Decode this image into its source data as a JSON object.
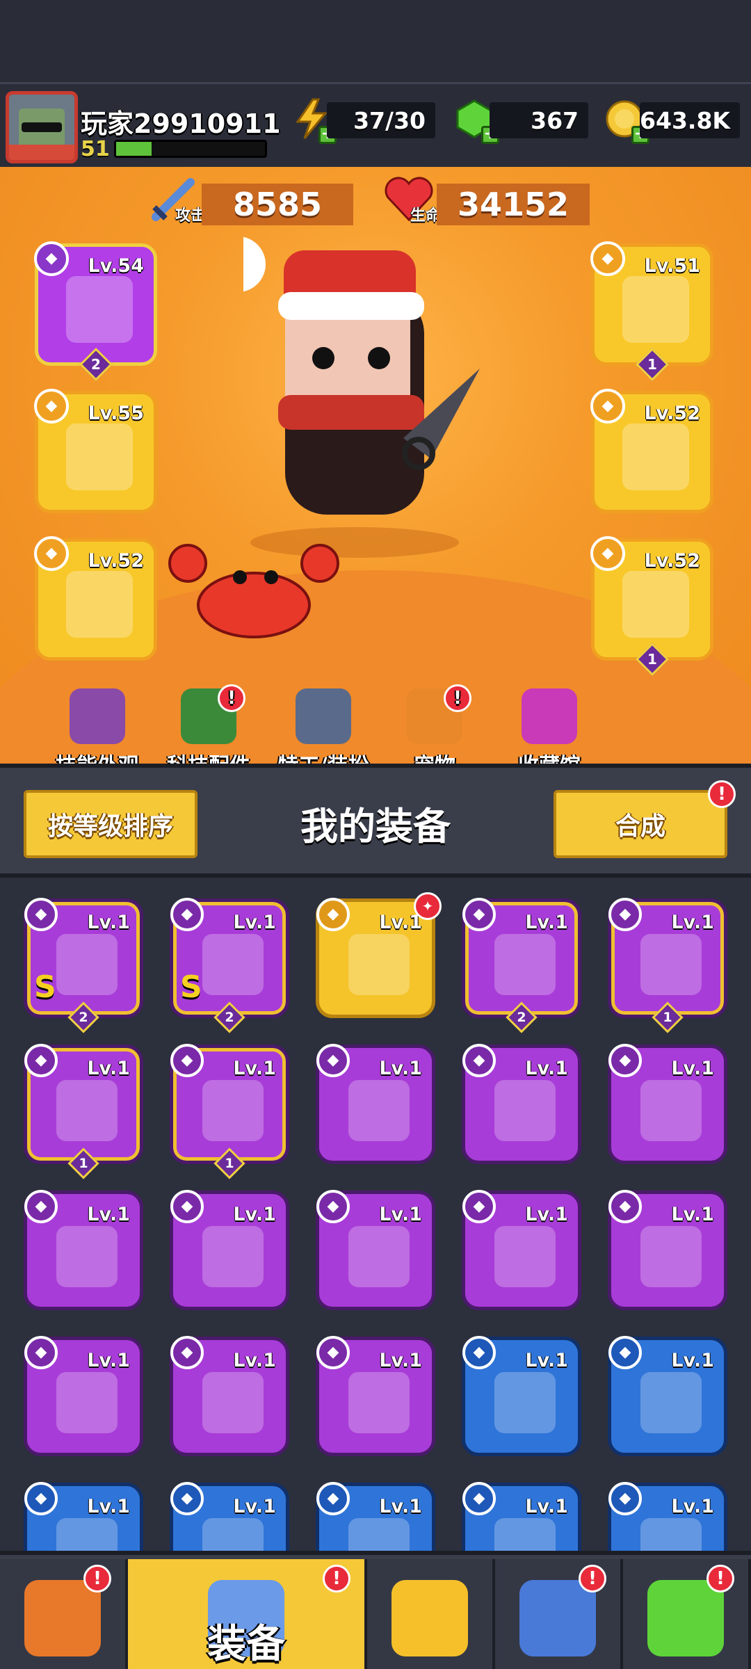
{
  "player": {
    "name": "玩家29910911",
    "level": "51",
    "xp_fraction": 0.24
  },
  "resources": {
    "energy": "37/30",
    "gems": "367",
    "coins": "643.8K"
  },
  "stats": {
    "attack_label": "攻击",
    "attack": "8585",
    "hp_label": "生命",
    "hp": "34152"
  },
  "equipped": [
    {
      "slot": "weapon",
      "level": "Lv.54",
      "rarity": "purple",
      "icon": "kunai-icon",
      "stars": "2"
    },
    {
      "slot": "armor",
      "level": "Lv.51",
      "rarity": "yellow",
      "icon": "armor-icon",
      "stars": "1"
    },
    {
      "slot": "necklace",
      "level": "Lv.55",
      "rarity": "yellow",
      "icon": "necklace-icon",
      "stars": ""
    },
    {
      "slot": "belt",
      "level": "Lv.52",
      "rarity": "yellow",
      "icon": "belt-icon",
      "stars": ""
    },
    {
      "slot": "glove",
      "level": "Lv.52",
      "rarity": "yellow",
      "icon": "glove-icon",
      "stars": ""
    },
    {
      "slot": "boots",
      "level": "Lv.52",
      "rarity": "yellow",
      "icon": "boots-icon",
      "stars": "1"
    }
  ],
  "menu": [
    {
      "label": "技能外观",
      "icon": "skill-skin-icon",
      "badge": false
    },
    {
      "label": "科技配件",
      "icon": "tech-parts-icon",
      "badge": true
    },
    {
      "label": "特工/装扮",
      "icon": "agent-outfit-icon",
      "badge": false
    },
    {
      "label": "宠物",
      "icon": "pet-icon",
      "badge": true
    },
    {
      "label": "收藏馆",
      "icon": "collection-icon",
      "badge": false
    }
  ],
  "inventory_bar": {
    "sort_label": "按等级排序",
    "title": "我的装备",
    "merge_label": "合成"
  },
  "inventory": [
    {
      "level": "Lv.1",
      "rarity": "p",
      "gold": true,
      "icon": "necklace-icon",
      "s": "S",
      "stars": "2",
      "new": false
    },
    {
      "level": "Lv.1",
      "rarity": "p",
      "gold": true,
      "icon": "belt-icon",
      "s": "S",
      "stars": "2",
      "new": false
    },
    {
      "level": "Lv.1",
      "rarity": "y",
      "gold": false,
      "icon": "revolver-icon",
      "s": "",
      "stars": "",
      "new": true
    },
    {
      "level": "Lv.1",
      "rarity": "p",
      "gold": true,
      "icon": "glove-icon",
      "s": "",
      "stars": "2",
      "new": false
    },
    {
      "level": "Lv.1",
      "rarity": "p",
      "gold": true,
      "icon": "fang-necklace-icon",
      "s": "",
      "stars": "1",
      "new": false
    },
    {
      "level": "Lv.1",
      "rarity": "p",
      "gold": true,
      "icon": "fang-necklace-icon",
      "s": "",
      "stars": "1",
      "new": false
    },
    {
      "level": "Lv.1",
      "rarity": "p",
      "gold": true,
      "icon": "boots-icon",
      "s": "",
      "stars": "1",
      "new": false
    },
    {
      "level": "Lv.1",
      "rarity": "p",
      "gold": false,
      "icon": "revolver-icon",
      "s": "",
      "stars": "",
      "new": false
    },
    {
      "level": "Lv.1",
      "rarity": "p",
      "gold": false,
      "icon": "drumstick-icon",
      "s": "",
      "stars": "",
      "new": false
    },
    {
      "level": "Lv.1",
      "rarity": "p",
      "gold": false,
      "icon": "rope-belt-icon",
      "s": "",
      "stars": "",
      "new": false
    },
    {
      "level": "Lv.1",
      "rarity": "p",
      "gold": false,
      "icon": "rope-belt-icon",
      "s": "",
      "stars": "",
      "new": false
    },
    {
      "level": "Lv.1",
      "rarity": "p",
      "gold": false,
      "icon": "belt-icon",
      "s": "",
      "stars": "",
      "new": false
    },
    {
      "level": "Lv.1",
      "rarity": "p",
      "gold": false,
      "icon": "belt-icon",
      "s": "",
      "stars": "",
      "new": false
    },
    {
      "level": "Lv.1",
      "rarity": "p",
      "gold": false,
      "icon": "star-belt-icon",
      "s": "",
      "stars": "",
      "new": false
    },
    {
      "level": "Lv.1",
      "rarity": "p",
      "gold": false,
      "icon": "glove-icon",
      "s": "",
      "stars": "",
      "new": false
    },
    {
      "level": "Lv.1",
      "rarity": "p",
      "gold": false,
      "icon": "glove-icon",
      "s": "",
      "stars": "",
      "new": false
    },
    {
      "level": "Lv.1",
      "rarity": "p",
      "gold": false,
      "icon": "glove-icon",
      "s": "",
      "stars": "",
      "new": false
    },
    {
      "level": "Lv.1",
      "rarity": "p",
      "gold": false,
      "icon": "boots-icon",
      "s": "",
      "stars": "",
      "new": false
    },
    {
      "level": "Lv.1",
      "rarity": "b",
      "gold": false,
      "icon": "kunai-icon",
      "s": "",
      "stars": "",
      "new": false
    },
    {
      "level": "Lv.1",
      "rarity": "b",
      "gold": false,
      "icon": "kunai-icon",
      "s": "",
      "stars": "",
      "new": false
    },
    {
      "level": "Lv.1",
      "rarity": "b",
      "gold": false,
      "icon": "katana-icon",
      "s": "",
      "stars": "",
      "new": false
    },
    {
      "level": "Lv.1",
      "rarity": "b",
      "gold": false,
      "icon": "boomerang-icon",
      "s": "",
      "stars": "",
      "new": false
    },
    {
      "level": "Lv.1",
      "rarity": "b",
      "gold": false,
      "icon": "revolver-icon",
      "s": "",
      "stars": "",
      "new": false
    },
    {
      "level": "Lv.1",
      "rarity": "b",
      "gold": false,
      "icon": "armor-icon",
      "s": "",
      "stars": "",
      "new": false
    },
    {
      "level": "Lv.1",
      "rarity": "b",
      "gold": false,
      "icon": "armor-icon",
      "s": "",
      "stars": "",
      "new": false
    }
  ],
  "nav": [
    {
      "label": "",
      "icon": "shop-icon",
      "badge": true
    },
    {
      "label": "装备",
      "icon": "equipment-icon",
      "badge": true
    },
    {
      "label": "",
      "icon": "battle-star-icon",
      "badge": false
    },
    {
      "label": "",
      "icon": "planet-icon",
      "badge": true
    },
    {
      "label": "",
      "icon": "dna-icon",
      "badge": true
    }
  ]
}
